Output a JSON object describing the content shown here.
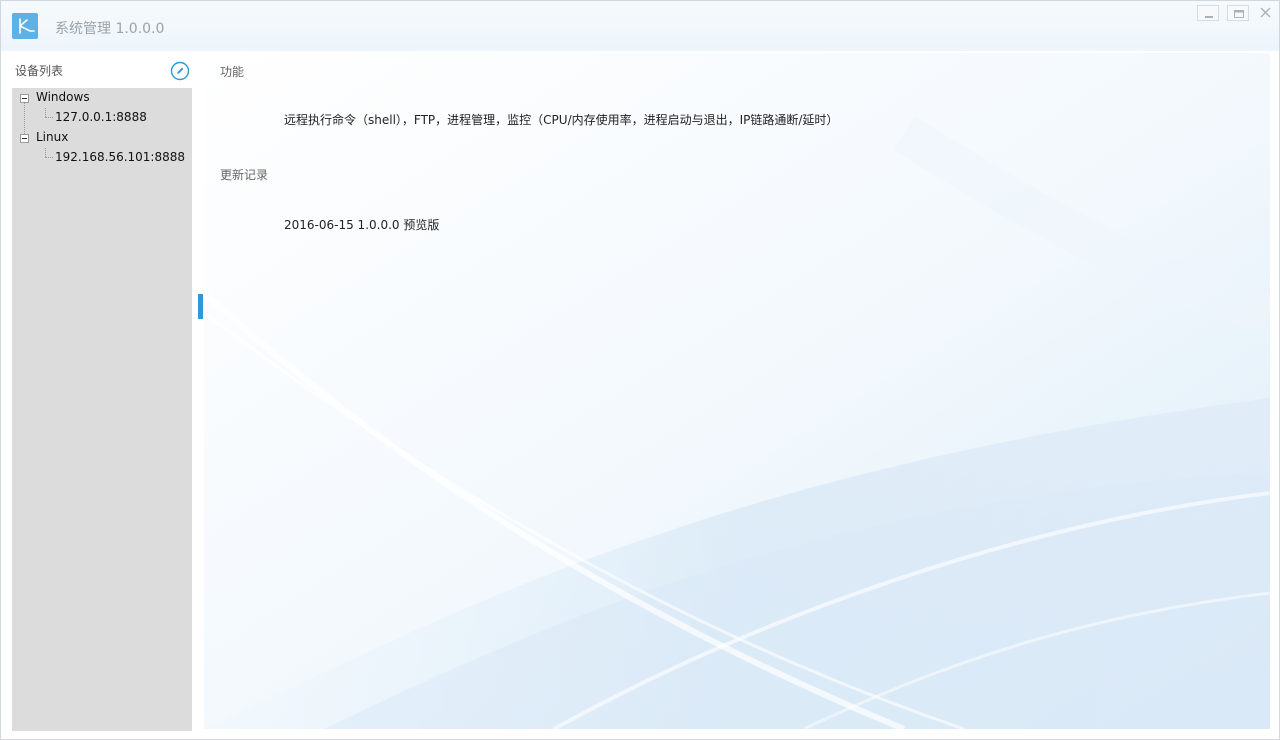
{
  "window": {
    "title": "系统管理 1.0.0.0",
    "controls": {
      "minimize": "minimize",
      "maximize": "maximize",
      "close": "close"
    }
  },
  "sidebar": {
    "header": "设备列表",
    "edit_icon": "edit-icon",
    "tree": [
      {
        "label": "Windows",
        "children": [
          {
            "label": "127.0.0.1:8888"
          }
        ]
      },
      {
        "label": "Linux",
        "children": [
          {
            "label": "192.168.56.101:8888"
          }
        ]
      }
    ]
  },
  "main": {
    "sections": [
      {
        "title": "功能",
        "body": "远程执行命令（shell），FTP，进程管理，监控（CPU/内存使用率，进程启动与退出，IP链路通断/延时）"
      },
      {
        "title": "更新记录",
        "body": "2016-06-15 1.0.0.0 预览版"
      }
    ]
  },
  "colors": {
    "accent": "#2e9ad3",
    "logo": "#5db1e6",
    "tree_bg": "#dcdcdc"
  }
}
